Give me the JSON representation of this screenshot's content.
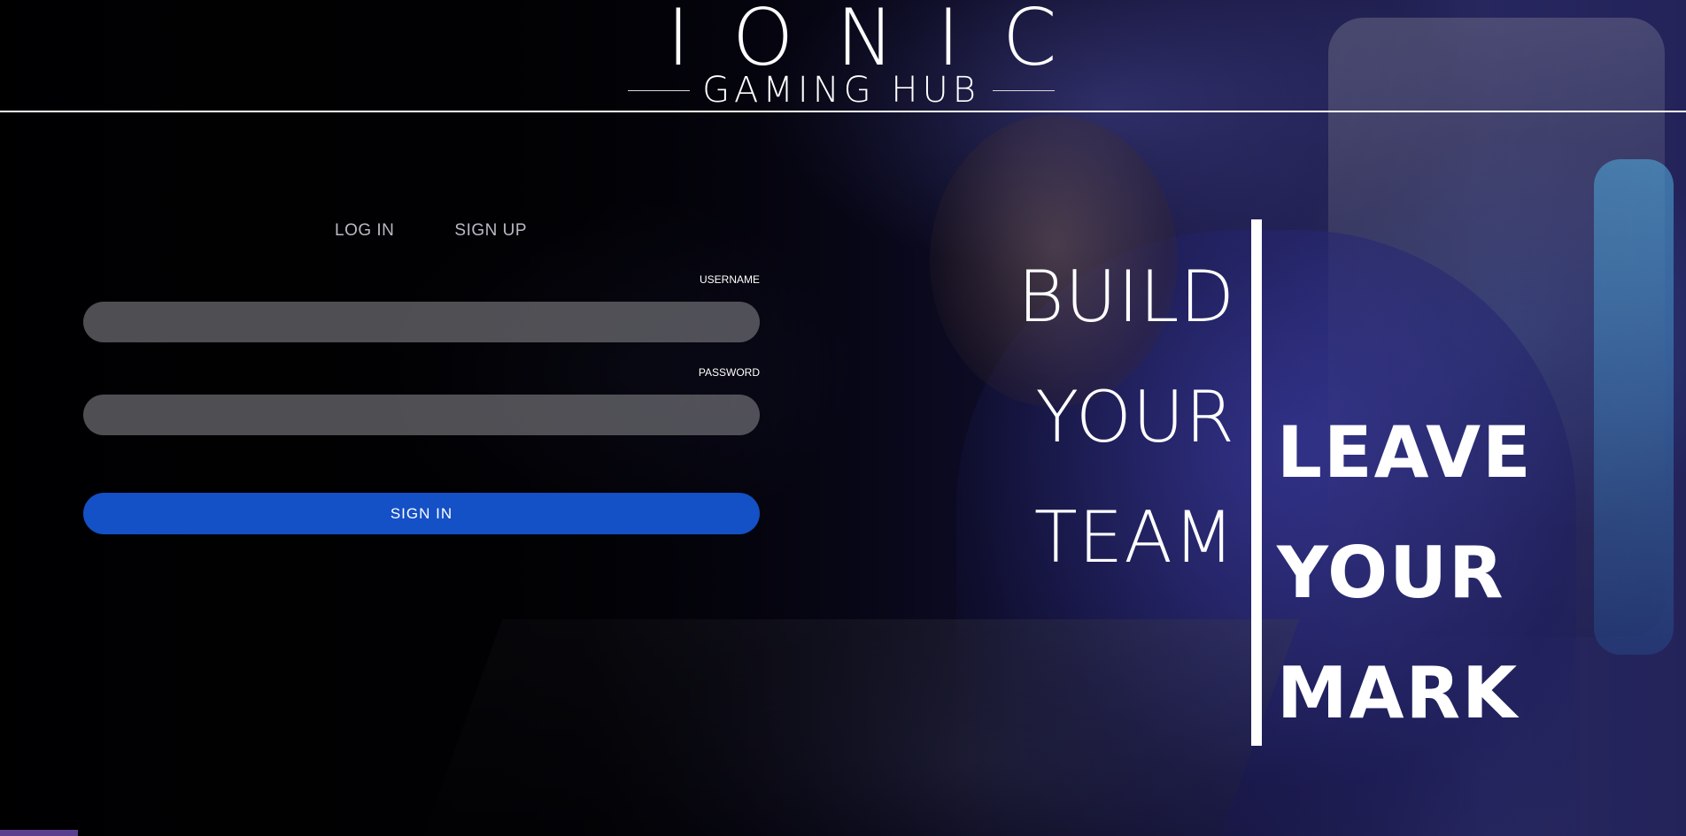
{
  "header": {
    "logo_main": "IONIC",
    "logo_sub": "GAMING HUB"
  },
  "tabs": [
    {
      "label": "LOG IN"
    },
    {
      "label": "SIGN UP"
    }
  ],
  "form": {
    "username_label": "USERNAME",
    "username_value": "",
    "password_label": "PASSWORD",
    "password_value": "",
    "signin_label": "SIGN IN"
  },
  "slogan": {
    "left": [
      "BUILD",
      "YOUR",
      "TEAM"
    ],
    "right": [
      "LEAVE",
      "YOUR",
      "MARK"
    ]
  },
  "colors": {
    "accent": "#1450c6",
    "corner": "#5a3f8f"
  }
}
